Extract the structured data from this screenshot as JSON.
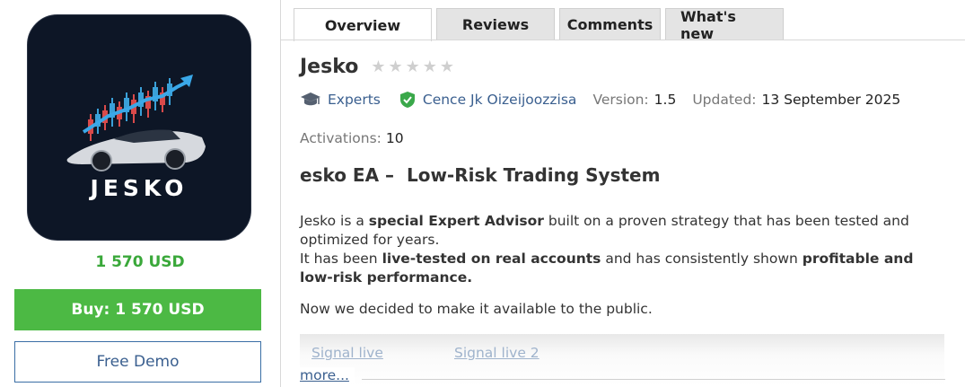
{
  "product": {
    "logo_text": "JESKO",
    "price": "1 570 USD",
    "buy_label": "Buy: 1 570 USD",
    "demo_label": "Free Demo"
  },
  "tabs": [
    {
      "label": "Overview",
      "active": true
    },
    {
      "label": "Reviews",
      "active": false
    },
    {
      "label": "Comments",
      "active": false
    },
    {
      "label": "What's new",
      "active": false
    }
  ],
  "title": "Jesko",
  "rating": {
    "stars_filled": 0,
    "stars_total": 5
  },
  "meta": {
    "category": "Experts",
    "author": "Cence Jk Oizeijoozzisa",
    "version_label": "Version:",
    "version": "1.5",
    "updated_label": "Updated:",
    "updated": "13 September 2025",
    "activations_label": "Activations:",
    "activations": "10"
  },
  "heading": "esko EA –  Low-Risk Trading System",
  "description": {
    "p1_a": "Jesko is a ",
    "p1_b": "special Expert Advisor",
    "p1_c": " built on a proven strategy that has been tested and optimized for years.",
    "p2_a": "It has been ",
    "p2_b": "live-tested on real accounts",
    "p2_c": " and has consistently shown ",
    "p2_d": "profitable and low-risk performance.",
    "p3": "Now we decided to make it available to the public."
  },
  "signals": [
    "Signal live",
    "Signal live 2"
  ],
  "more_label": "more..."
}
